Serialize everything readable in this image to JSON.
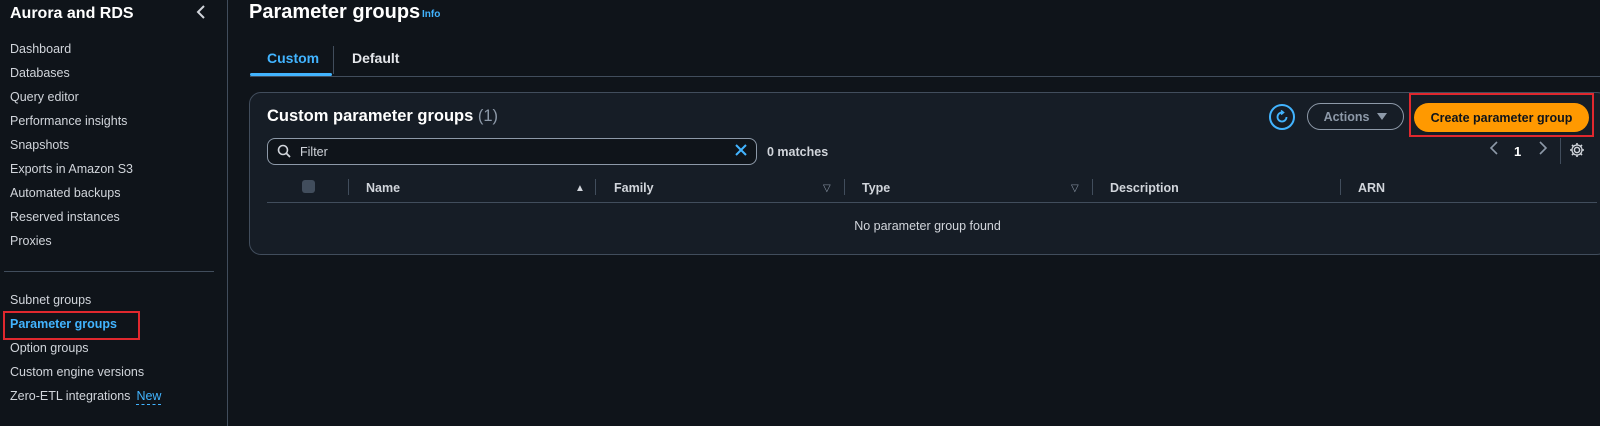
{
  "sidebar": {
    "title": "Aurora and RDS",
    "items": [
      {
        "label": "Dashboard"
      },
      {
        "label": "Databases"
      },
      {
        "label": "Query editor"
      },
      {
        "label": "Performance insights"
      },
      {
        "label": "Snapshots"
      },
      {
        "label": "Exports in Amazon S3"
      },
      {
        "label": "Automated backups"
      },
      {
        "label": "Reserved instances"
      },
      {
        "label": "Proxies"
      }
    ],
    "items2": [
      {
        "label": "Subnet groups"
      },
      {
        "label": "Parameter groups",
        "active": true
      },
      {
        "label": "Option groups"
      },
      {
        "label": "Custom engine versions"
      },
      {
        "label": "Zero-ETL integrations",
        "badge": "New"
      }
    ]
  },
  "header": {
    "title": "Parameter groups",
    "info": "Info"
  },
  "tabs": [
    {
      "label": "Custom",
      "active": true
    },
    {
      "label": "Default"
    }
  ],
  "panel": {
    "title": "Custom parameter groups",
    "count": "(1)",
    "actions_label": "Actions",
    "create_label": "Create parameter group",
    "filter_placeholder": "Filter",
    "matches": "0 matches",
    "page": "1",
    "columns": [
      "Name",
      "Family",
      "Type",
      "Description",
      "ARN"
    ],
    "empty_message": "No parameter group found"
  },
  "colors": {
    "accent": "#42b4ff",
    "primary_button": "#ff9900",
    "highlight": "#e0282e",
    "background": "#0f141a"
  }
}
